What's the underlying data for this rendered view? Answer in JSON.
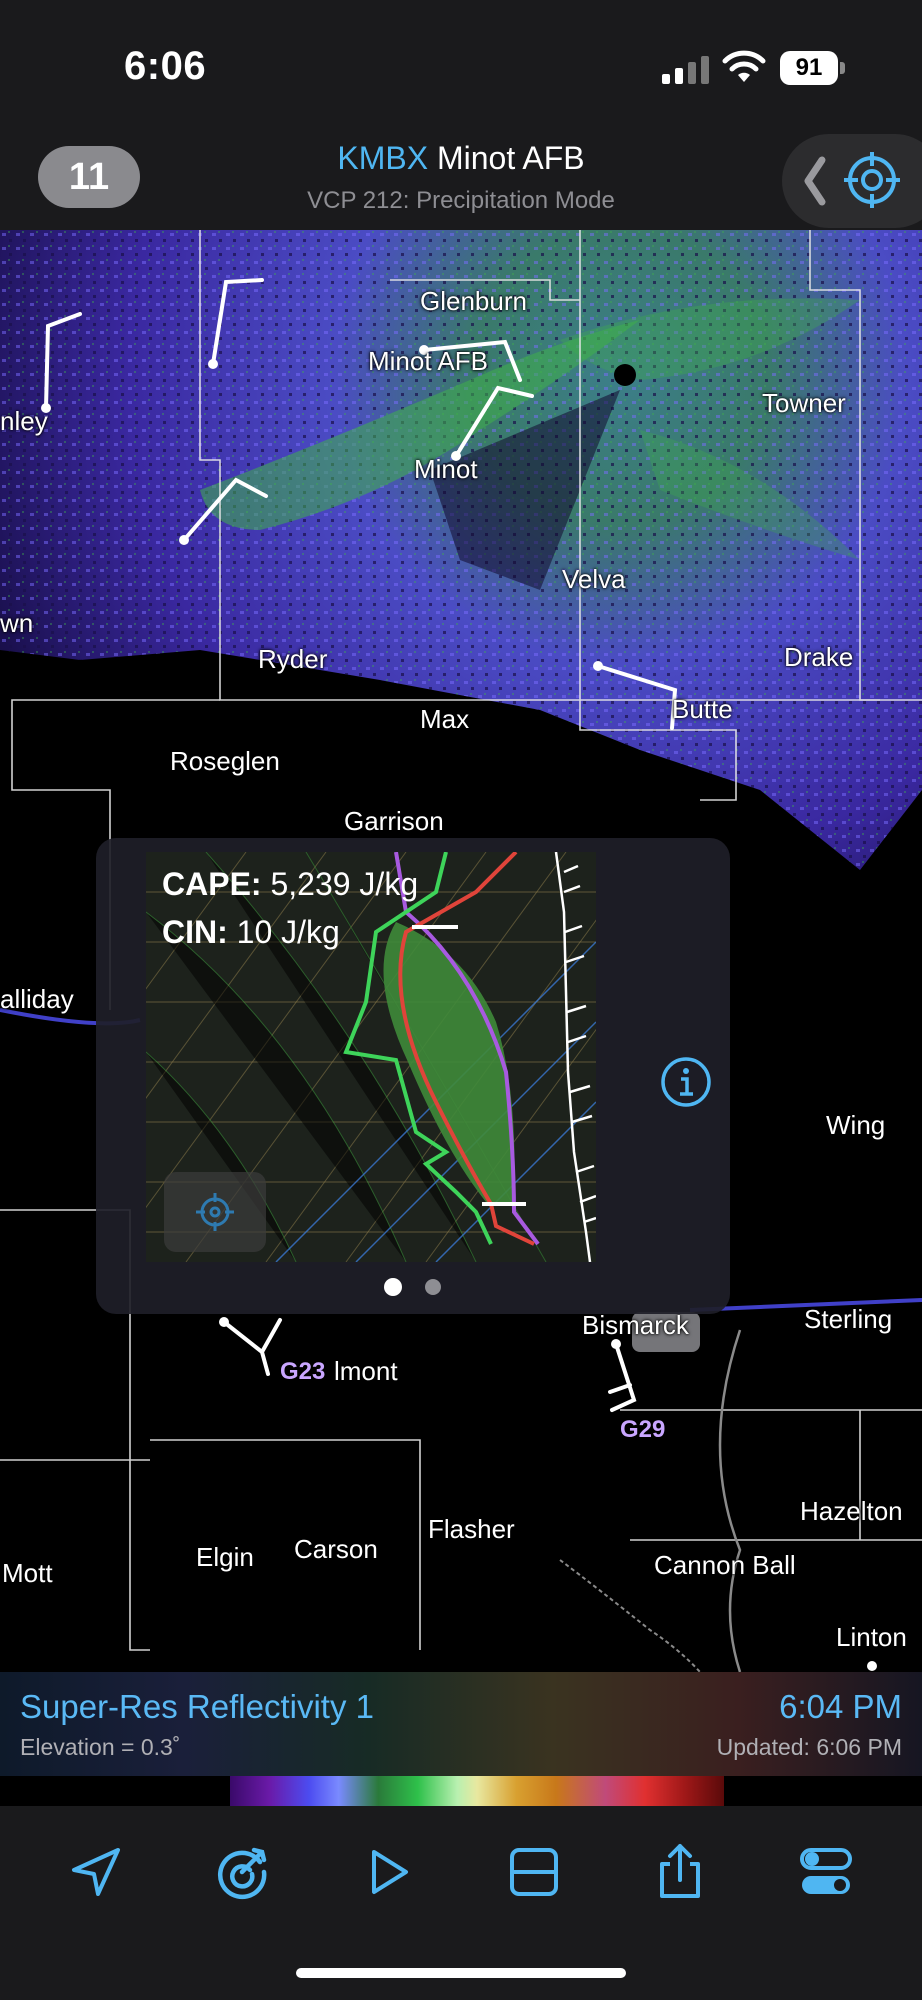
{
  "status": {
    "time": "6:06",
    "battery": "91"
  },
  "header": {
    "count": "11",
    "station_id": "KMBX",
    "station_name": "Minot AFB",
    "vcp_mode": "VCP 212: Precipitation Mode"
  },
  "map": {
    "towns": [
      {
        "name": "Glenburn"
      },
      {
        "name": "Minot AFB"
      },
      {
        "name": "Towner"
      },
      {
        "name": "Minot"
      },
      {
        "name": "nley"
      },
      {
        "name": "Velva"
      },
      {
        "name": "wn"
      },
      {
        "name": "Ryder"
      },
      {
        "name": "Drake"
      },
      {
        "name": "Max"
      },
      {
        "name": "Butte"
      },
      {
        "name": "Roseglen"
      },
      {
        "name": "Garrison"
      },
      {
        "name": "alliday"
      },
      {
        "name": "Wing"
      },
      {
        "name": "Sterling"
      },
      {
        "name": "Bismarck"
      },
      {
        "name": "Flasher"
      },
      {
        "name": "Hazelton"
      },
      {
        "name": "Carson"
      },
      {
        "name": "Elgin"
      },
      {
        "name": "Cannon Ball"
      },
      {
        "name": "Mott"
      },
      {
        "name": "Linton"
      },
      {
        "name": "lmont"
      }
    ],
    "gusts": [
      "G23",
      "G29"
    ]
  },
  "sounding": {
    "cape_label": "CAPE:",
    "cape_value": "5,239 J/kg",
    "cin_label": "CIN:",
    "cin_value": "10 J/kg",
    "colors": {
      "temperature": "#e0443a",
      "dewpoint": "#3ed45a",
      "parcel": "#a85ae0",
      "cape_fill": "#3f8a3a"
    }
  },
  "product": {
    "name": "Super-Res Reflectivity 1",
    "elevation": "Elevation = 0.3˚",
    "scan_time": "6:04 PM",
    "updated": "Updated: 6:06 PM"
  },
  "toolbar": {
    "icons": [
      "location-arrow-icon",
      "radar-icon",
      "play-icon",
      "split-view-icon",
      "share-icon",
      "settings-toggle-icon"
    ]
  },
  "colors": {
    "accent": "#4fb6f2",
    "reflectivity_light": "#5a4ad8",
    "reflectivity_green": "#3fb04a"
  }
}
